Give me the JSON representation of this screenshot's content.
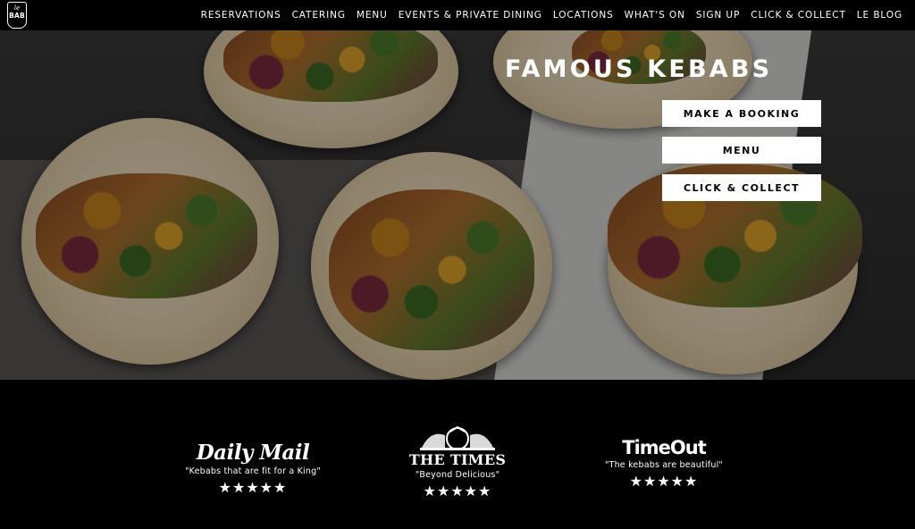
{
  "brand": {
    "logo_top": "le",
    "logo_bottom": "BAB"
  },
  "nav": {
    "items": [
      "RESERVATIONS",
      "CATERING",
      "MENU",
      "EVENTS & PRIVATE DINING",
      "LOCATIONS",
      "WHAT'S ON",
      "SIGN UP",
      "CLICK & COLLECT",
      "LE BLOG"
    ]
  },
  "hero": {
    "title": "FAMOUS KEBABS",
    "buttons": [
      "MAKE A BOOKING",
      "MENU",
      "CLICK & COLLECT"
    ]
  },
  "press": [
    {
      "masthead": "Daily Mail",
      "quote": "\"Kebabs that are fit for a King\"",
      "stars": "★★★★★"
    },
    {
      "masthead": "THE TIMES",
      "quote": "\"Beyond Delicious\"",
      "stars": "★★★★★"
    },
    {
      "masthead": "TimeOut",
      "quote": "\"The kebabs are beautiful\"",
      "stars": "★★★★★"
    }
  ]
}
